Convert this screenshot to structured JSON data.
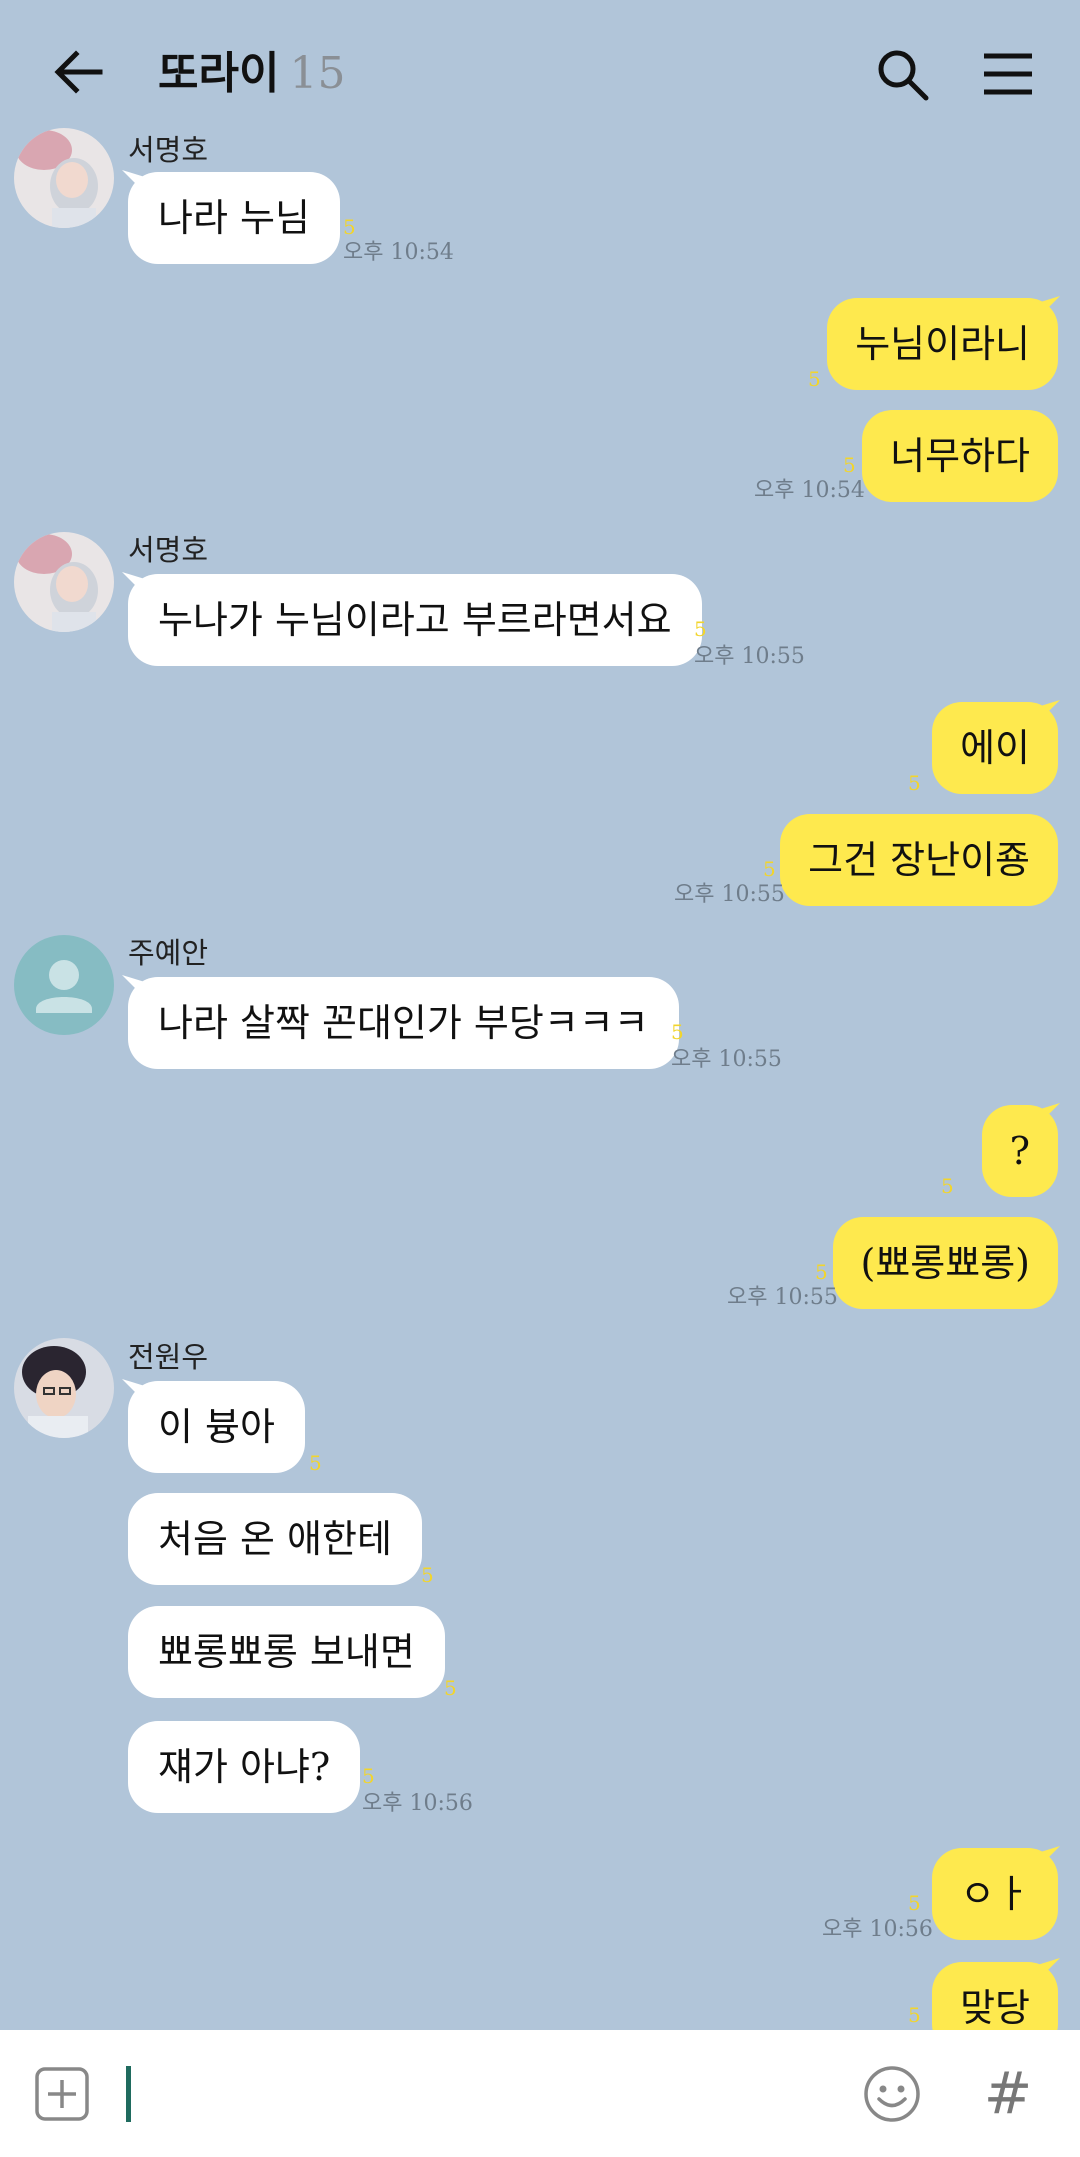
{
  "header": {
    "title": "또라이",
    "member_count": "15",
    "icons": [
      "back-arrow-icon",
      "search-icon",
      "menu-icon"
    ]
  },
  "messages": [
    {
      "sender": "서명호",
      "side": "in",
      "text": "나라 누님",
      "unread": "5",
      "time": "오후 10:54"
    },
    {
      "side": "out",
      "text": "누님이라니",
      "unread": "5"
    },
    {
      "side": "out",
      "text": "너무하다",
      "unread": "5",
      "time": "오후 10:54"
    },
    {
      "sender": "서명호",
      "side": "in",
      "text": "누나가 누님이라고 부르라면서요",
      "unread": "5",
      "time": "오후 10:55"
    },
    {
      "side": "out",
      "text": "에이",
      "unread": "5"
    },
    {
      "side": "out",
      "text": "그건 장난이죵",
      "unread": "5",
      "time": "오후 10:55"
    },
    {
      "sender": "주예안",
      "side": "in",
      "text": "나라 살짝 꼰대인가 부당ㅋㅋㅋ",
      "unread": "5",
      "time": "오후 10:55"
    },
    {
      "side": "out",
      "text": "?",
      "unread": "5"
    },
    {
      "side": "out",
      "text": "(뾰롱뾰롱)",
      "unread": "5",
      "time": "오후 10:55"
    },
    {
      "sender": "전원우",
      "side": "in",
      "text": "이 븅아",
      "unread": "5"
    },
    {
      "side": "in",
      "text": "처음 온 애한테",
      "unread": "5"
    },
    {
      "side": "in",
      "text": "뾰롱뾰롱 보내면",
      "unread": "5"
    },
    {
      "side": "in",
      "text": "쟤가 아냐?",
      "unread": "5",
      "time": "오후 10:56"
    },
    {
      "side": "out",
      "text": "ㅇㅏ",
      "unread": "5",
      "time": "오후 10:56"
    },
    {
      "side": "out",
      "text": "맞당",
      "unread": "5"
    }
  ],
  "input": {
    "value": "",
    "icons": [
      "plus-icon",
      "emoji-icon",
      "hashtag-icon"
    ],
    "hash_glyph": "#"
  },
  "colors": {
    "background": "#b1c5d9",
    "outgoing_bubble": "#fee94e",
    "incoming_bubble": "#ffffff",
    "unread": "#f2d52c"
  }
}
